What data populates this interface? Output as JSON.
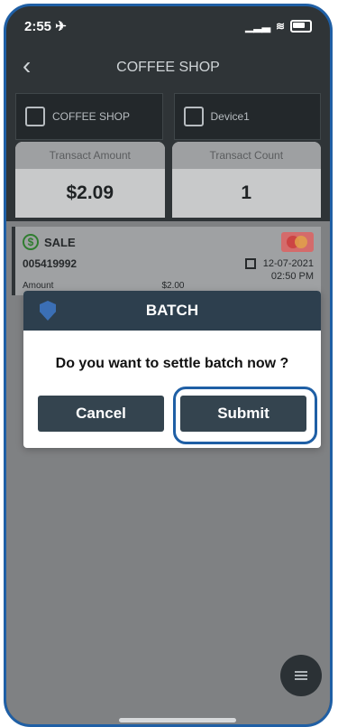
{
  "status": {
    "time": "2:55 ✈",
    "signal": "▁▂▃",
    "wifi": "≋"
  },
  "header": {
    "title": "COFFEE SHOP"
  },
  "selectors": [
    {
      "label": "COFFEE SHOP"
    },
    {
      "label": "Device1"
    }
  ],
  "stats": [
    {
      "label": "Transact Amount",
      "value": "$2.09"
    },
    {
      "label": "Transact Count",
      "value": "1"
    }
  ],
  "transaction": {
    "type": "SALE",
    "id": "005419992",
    "amount_label": "Amount",
    "amount": "$2.00",
    "date": "12-07-2021",
    "time": "02:50 PM"
  },
  "dialog": {
    "title": "BATCH",
    "message": "Do you want to settle batch now ?",
    "cancel_label": "Cancel",
    "submit_label": "Submit"
  },
  "colors": {
    "accent": "#1f5fa5",
    "dialog_header": "#2d3f4e",
    "button": "#34444f",
    "page_bg": "#2f3437"
  },
  "icons": {
    "back": "chevron-left-icon",
    "store": "store-icon",
    "device": "device-icon",
    "sale": "dollar-icon",
    "card": "mastercard-icon",
    "calendar": "calendar-icon",
    "shield": "shield-icon",
    "menu": "menu-icon"
  }
}
